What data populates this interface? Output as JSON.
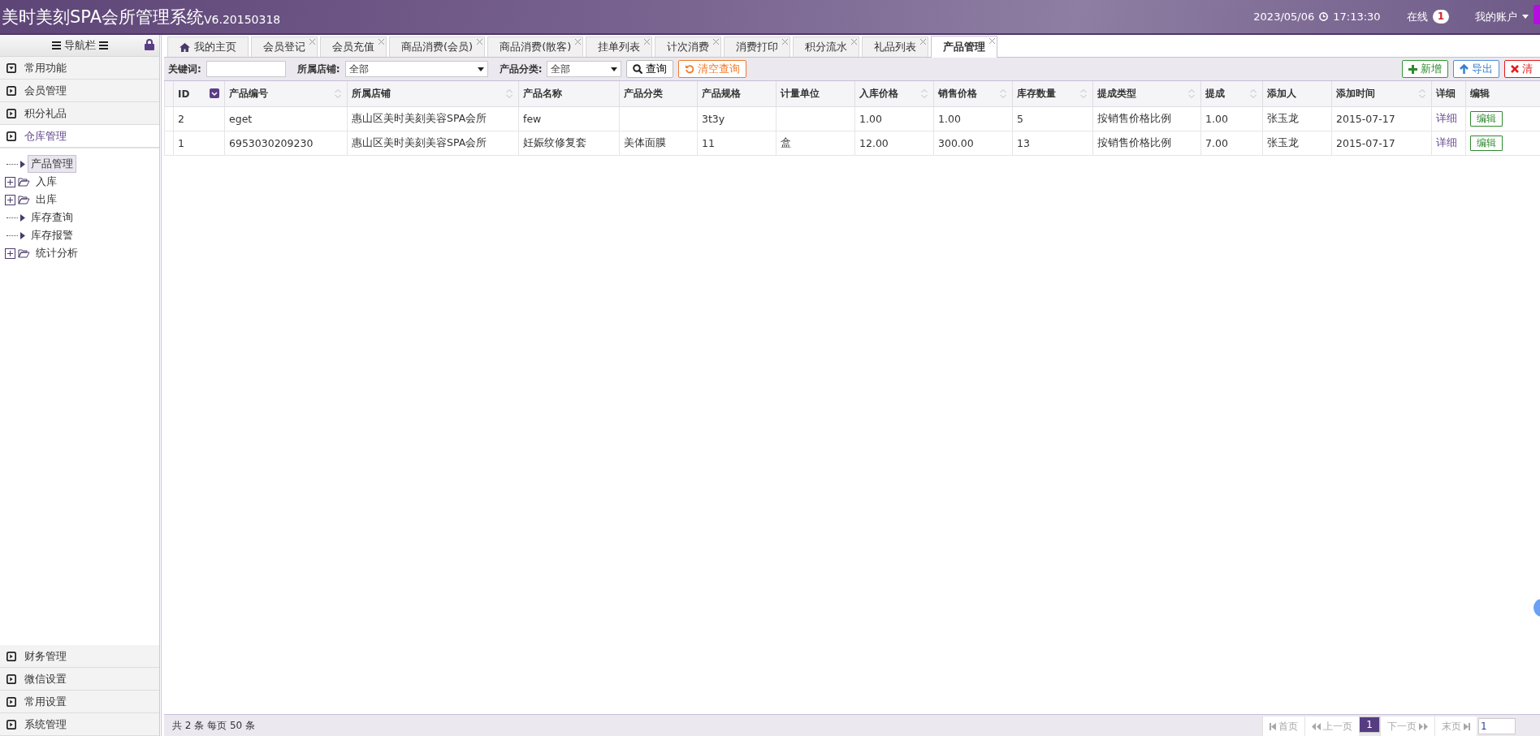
{
  "header": {
    "title": "美时美刻SPA会所管理系统",
    "version": "V6.20150318",
    "date": "2023/05/06",
    "time": "17:13:30",
    "online_label": "在线",
    "online_count": "1",
    "account": "我的账户"
  },
  "sidebar": {
    "title": "导航栏",
    "sections_top": [
      {
        "label": "常用功能",
        "kind": "down",
        "selected": false
      },
      {
        "label": "会员管理",
        "kind": "right",
        "selected": false
      },
      {
        "label": "积分礼品",
        "kind": "right",
        "selected": false
      },
      {
        "label": "仓库管理",
        "kind": "right",
        "selected": true
      }
    ],
    "tree": [
      {
        "label": "产品管理",
        "kind": "leaf",
        "selected": true
      },
      {
        "label": "入库",
        "kind": "folder",
        "selected": false
      },
      {
        "label": "出库",
        "kind": "folder",
        "selected": false
      },
      {
        "label": "库存查询",
        "kind": "leaf",
        "selected": false
      },
      {
        "label": "库存报警",
        "kind": "leaf",
        "selected": false
      },
      {
        "label": "统计分析",
        "kind": "folder",
        "selected": false
      }
    ],
    "sections_bottom": [
      {
        "label": "财务管理",
        "kind": "right",
        "selected": false
      },
      {
        "label": "微信设置",
        "kind": "right",
        "selected": false
      },
      {
        "label": "常用设置",
        "kind": "right",
        "selected": false
      },
      {
        "label": "系统管理",
        "kind": "right",
        "selected": false
      }
    ]
  },
  "tabs": [
    {
      "label": "我的主页",
      "kind": "home",
      "selected": false
    },
    {
      "label": "会员登记",
      "kind": "page",
      "selected": false
    },
    {
      "label": "会员充值",
      "kind": "page",
      "selected": false
    },
    {
      "label": "商品消费(会员)",
      "kind": "page",
      "selected": false
    },
    {
      "label": "商品消费(散客)",
      "kind": "page",
      "selected": false
    },
    {
      "label": "挂单列表",
      "kind": "page",
      "selected": false
    },
    {
      "label": "计次消费",
      "kind": "page",
      "selected": false
    },
    {
      "label": "消费打印",
      "kind": "page",
      "selected": false
    },
    {
      "label": "积分流水",
      "kind": "page",
      "selected": false
    },
    {
      "label": "礼品列表",
      "kind": "page",
      "selected": false
    },
    {
      "label": "产品管理",
      "kind": "page",
      "selected": true
    }
  ],
  "filters": {
    "keyword_label": "关键词:",
    "store_label": "所属店铺:",
    "store_value": "全部",
    "category_label": "产品分类:",
    "category_value": "全部",
    "search_button": "查询",
    "clear_button": "清空查询"
  },
  "actions": [
    {
      "kind": "add",
      "label": "新增"
    },
    {
      "kind": "export",
      "label": "导出"
    },
    {
      "kind": "clean",
      "label": "清"
    }
  ],
  "table": {
    "columns": [
      {
        "label": "ID",
        "sortable": true,
        "sorted": true
      },
      {
        "label": "产品编号",
        "sortable": true,
        "sorted": false
      },
      {
        "label": "所属店铺",
        "sortable": true,
        "sorted": false
      },
      {
        "label": "产品名称",
        "sortable": false,
        "sorted": false
      },
      {
        "label": "产品分类",
        "sortable": false,
        "sorted": false
      },
      {
        "label": "产品规格",
        "sortable": false,
        "sorted": false
      },
      {
        "label": "计量单位",
        "sortable": false,
        "sorted": false
      },
      {
        "label": "入库价格",
        "sortable": true,
        "sorted": false
      },
      {
        "label": "销售价格",
        "sortable": true,
        "sorted": false
      },
      {
        "label": "库存数量",
        "sortable": true,
        "sorted": false
      },
      {
        "label": "提成类型",
        "sortable": true,
        "sorted": false
      },
      {
        "label": "提成",
        "sortable": true,
        "sorted": false
      },
      {
        "label": "添加人",
        "sortable": false,
        "sorted": false
      },
      {
        "label": "添加时间",
        "sortable": true,
        "sorted": false
      },
      {
        "label": "详细",
        "sortable": false,
        "sorted": false
      },
      {
        "label": "编辑",
        "sortable": false,
        "sorted": false
      }
    ],
    "rows": [
      {
        "cells": [
          "2",
          "eget",
          "惠山区美时美刻美容SPA会所",
          "few",
          null,
          "3t3y",
          null,
          "1.00",
          "1.00",
          "5",
          "按销售价格比例",
          "1.00",
          "张玉龙",
          "2015-07-17"
        ],
        "detail": "详细",
        "edit": "编辑"
      },
      {
        "cells": [
          "1",
          "6953030209230",
          "惠山区美时美刻美容SPA会所",
          "妊娠纹修复套",
          "美体面膜",
          "11",
          "盒",
          "12.00",
          "300.00",
          "13",
          "按销售价格比例",
          "7.00",
          "张玉龙",
          "2015-07-17"
        ],
        "detail": "详细",
        "edit": "编辑"
      }
    ]
  },
  "footer": {
    "summary": "共 2 条 每页 50 条",
    "pager": [
      {
        "kind": "first",
        "label": "首页",
        "disabled": true,
        "selected": false
      },
      {
        "kind": "prev",
        "label": "上一页",
        "disabled": true,
        "selected": false
      },
      {
        "kind": "page",
        "label": "1",
        "disabled": false,
        "selected": true
      },
      {
        "kind": "next",
        "label": "下一页",
        "disabled": true,
        "selected": false
      },
      {
        "kind": "last",
        "label": "末页",
        "disabled": true,
        "selected": false
      }
    ],
    "page_input": "1"
  }
}
